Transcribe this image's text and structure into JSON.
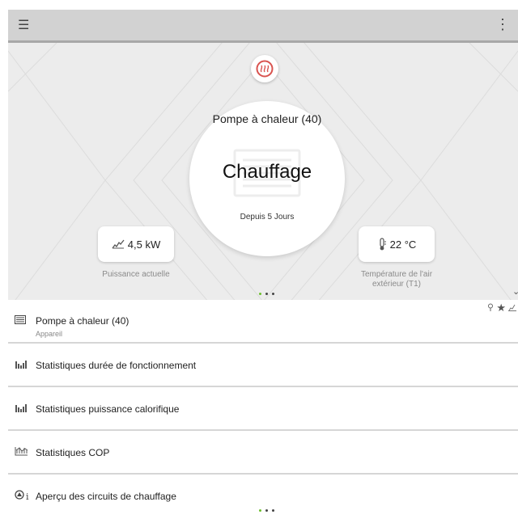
{
  "topbar": {
    "menu_icon": "hamburger-menu-icon",
    "more_icon": "more-vertical-icon"
  },
  "hero": {
    "status_icon": "heating-icon",
    "device_name": "Pompe à chaleur (40)",
    "mode": "Chauffage",
    "since": "Depuis 5 Jours",
    "power": {
      "value": "4,5 kW",
      "label": "Puissance actuelle",
      "icon": "power-chart-icon"
    },
    "temperature": {
      "value": "22 °C",
      "label": "Température de l'air extérieur (T1)",
      "icon": "thermometer-icon"
    },
    "pager": {
      "count": 3,
      "active": 0
    }
  },
  "list": {
    "items": [
      {
        "label": "Pompe à chaleur (40)",
        "sublabel": "Appareil",
        "icon": "device-icon"
      },
      {
        "label": "Statistiques durée de fonctionnement",
        "icon": "bar-chart-icon"
      },
      {
        "label": "Statistiques puissance calorifique",
        "icon": "bar-chart-icon"
      },
      {
        "label": "Statistiques COP",
        "icon": "cop-chart-icon"
      },
      {
        "label": "Aperçu des circuits de chauffage",
        "icon": "circuit-info-icon"
      }
    ],
    "pager": {
      "count": 3,
      "active": 0
    }
  },
  "colors": {
    "accent": "#6cbf2d",
    "heating": "#d9534f",
    "topbar": "#d2d2d2",
    "hero_bg": "#ececec"
  }
}
